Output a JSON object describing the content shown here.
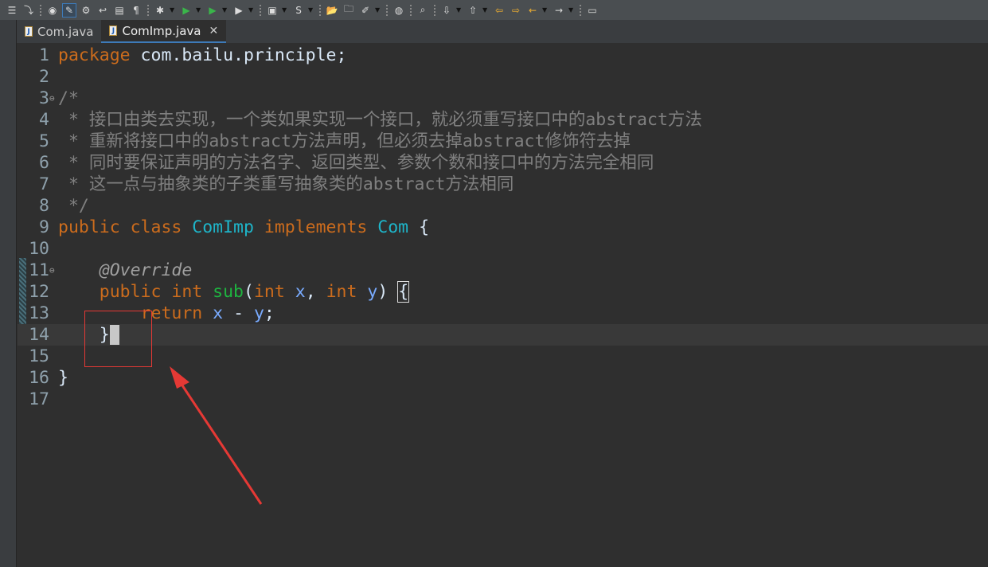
{
  "toolbar": {
    "icons": [
      "toggle-list-icon",
      "step-icon",
      "new-class-icon",
      "highlight-icon",
      "debug-view-icon",
      "return-icon",
      "console-icon",
      "pilcrow-icon",
      "bug-icon",
      "run-icon",
      "coverage-icon",
      "external-tools-icon",
      "new-server-icon",
      "new-s-icon",
      "open-folder-icon",
      "open-project-icon",
      "brush-icon",
      "globe-icon",
      "search-icon",
      "next-annotation-icon",
      "previous-annotation-icon",
      "back-edit-icon",
      "forward-edit-icon",
      "back-icon",
      "forward-icon",
      "new-window-icon"
    ]
  },
  "tabs": [
    {
      "label": "Com.java",
      "active": false
    },
    {
      "label": "ComImp.java",
      "active": true
    }
  ],
  "colors": {
    "keyword": "#cc6c1d",
    "comment": "#808080",
    "class": "#1eb5c9",
    "param": "#79abff",
    "method": "#1eb540",
    "annotation": "#a0a0a0",
    "text": "#d9e8f7",
    "highlight_box": "#e53935"
  },
  "cursor_line": 14,
  "lines": [
    {
      "n": "1",
      "t": [
        [
          "kw",
          "package"
        ],
        [
          "txt",
          " com.bailu.principle;"
        ]
      ]
    },
    {
      "n": "2",
      "t": []
    },
    {
      "n": "3",
      "fold": true,
      "t": [
        [
          "cm",
          "/*"
        ]
      ]
    },
    {
      "n": "4",
      "t": [
        [
          "cm",
          " * 接口由类去实现，一个类如果实现一个接口，就必须重写接口中的abstract方法"
        ]
      ]
    },
    {
      "n": "5",
      "t": [
        [
          "cm",
          " * 重新将接口中的abstract方法声明，但必须去掉abstract修饰符去掉"
        ]
      ]
    },
    {
      "n": "6",
      "t": [
        [
          "cm",
          " * 同时要保证声明的方法名字、返回类型、参数个数和接口中的方法完全相同"
        ]
      ]
    },
    {
      "n": "7",
      "t": [
        [
          "cm",
          " * 这一点与抽象类的子类重写抽象类的abstract方法相同"
        ]
      ]
    },
    {
      "n": "8",
      "t": [
        [
          "cm",
          " */"
        ]
      ]
    },
    {
      "n": "9",
      "t": [
        [
          "kw",
          "public class "
        ],
        [
          "cls",
          "ComImp "
        ],
        [
          "kw",
          "implements "
        ],
        [
          "cls",
          "Com "
        ],
        [
          "txt",
          "{"
        ]
      ]
    },
    {
      "n": "10",
      "t": []
    },
    {
      "n": "11",
      "fold": true,
      "t": [
        [
          "txt",
          "    "
        ],
        [
          "ann",
          "@Override"
        ]
      ]
    },
    {
      "n": "12",
      "t": [
        [
          "txt",
          "    "
        ],
        [
          "kw",
          "public int "
        ],
        [
          "meth",
          "sub"
        ],
        [
          "txt",
          "("
        ],
        [
          "kw",
          "int "
        ],
        [
          "par",
          "x"
        ],
        [
          "txt",
          ", "
        ],
        [
          "kw",
          "int "
        ],
        [
          "par",
          "y"
        ],
        [
          "txt",
          ") "
        ],
        [
          "bracebox",
          "{"
        ]
      ]
    },
    {
      "n": "13",
      "t": [
        [
          "txt",
          "        "
        ],
        [
          "kw",
          "return "
        ],
        [
          "par",
          "x"
        ],
        [
          "txt",
          " - "
        ],
        [
          "par",
          "y"
        ],
        [
          "txt",
          ";"
        ]
      ]
    },
    {
      "n": "14",
      "t": [
        [
          "txt",
          "    }"
        ],
        [
          "caret",
          ""
        ]
      ]
    },
    {
      "n": "15",
      "t": []
    },
    {
      "n": "16",
      "t": [
        [
          "txt",
          "}"
        ]
      ]
    },
    {
      "n": "17",
      "t": []
    }
  ]
}
